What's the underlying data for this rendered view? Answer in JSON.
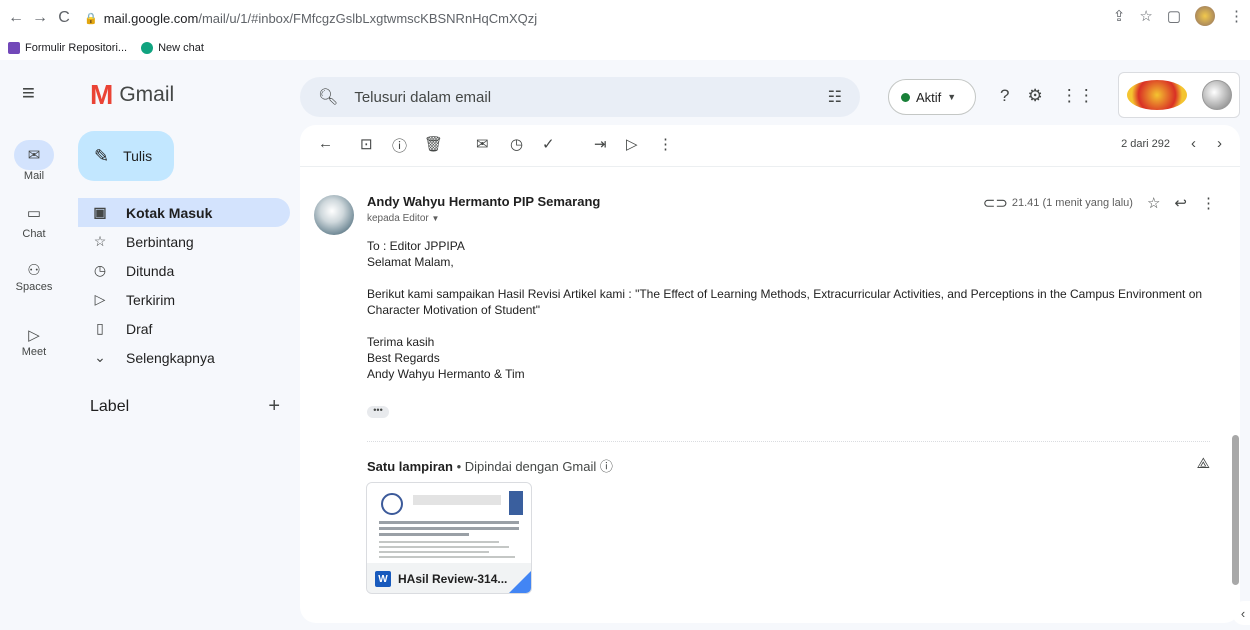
{
  "browser": {
    "url_host": "mail.google.com",
    "url_path": "/mail/u/1/#inbox/FMfcgzGslbLxgtwmscKBSNRnHqCmXQzj",
    "bookmarks": [
      {
        "label": "Formulir Repositori...",
        "icon": "forms-icon",
        "color": "#7248b9"
      },
      {
        "label": "New chat",
        "icon": "chatgpt-icon",
        "color": "#10a37f"
      }
    ]
  },
  "header": {
    "app_name": "Gmail",
    "search_placeholder": "Telusuri dalam email",
    "status_label": "Aktif"
  },
  "rail": {
    "items": [
      {
        "label": "Mail",
        "icon": "mail-icon"
      },
      {
        "label": "Chat",
        "icon": "chat-icon"
      },
      {
        "label": "Spaces",
        "icon": "spaces-icon"
      },
      {
        "label": "Meet",
        "icon": "meet-icon"
      }
    ]
  },
  "sidebar": {
    "compose_label": "Tulis",
    "items": [
      {
        "label": "Kotak Masuk",
        "icon": "inbox-icon",
        "active": true
      },
      {
        "label": "Berbintang",
        "icon": "star-icon"
      },
      {
        "label": "Ditunda",
        "icon": "clock-icon"
      },
      {
        "label": "Terkirim",
        "icon": "send-icon"
      },
      {
        "label": "Draf",
        "icon": "draft-icon"
      },
      {
        "label": "Selengkapnya",
        "icon": "chevron-down-icon"
      }
    ],
    "label_header": "Label"
  },
  "toolbar": {
    "pager_text": "2 dari 292"
  },
  "message": {
    "sender": "Andy Wahyu Hermanto PIP Semarang",
    "to_line": "kepada Editor",
    "time": "21.41 (1 menit yang lalu)",
    "body": {
      "line1": "To : Editor JPPIPA",
      "line2": "Selamat Malam,",
      "line3": "Berikut kami sampaikan Hasil Revisi Artikel kami :  \"The Effect of Learning Methods, Extracurricular Activities, and Perceptions in the Campus Environment on Character Motivation of Student\"",
      "line4": "Terima kasih",
      "line5": "Best Regards",
      "line6": "Andy Wahyu Hermanto & Tim"
    },
    "ellipsis": "•••"
  },
  "attachments": {
    "title": "Satu lampiran",
    "scan_note": " • Dipindai dengan Gmail ⓘ",
    "file_name": "HAsil Review-314...",
    "file_type_letter": "W"
  }
}
